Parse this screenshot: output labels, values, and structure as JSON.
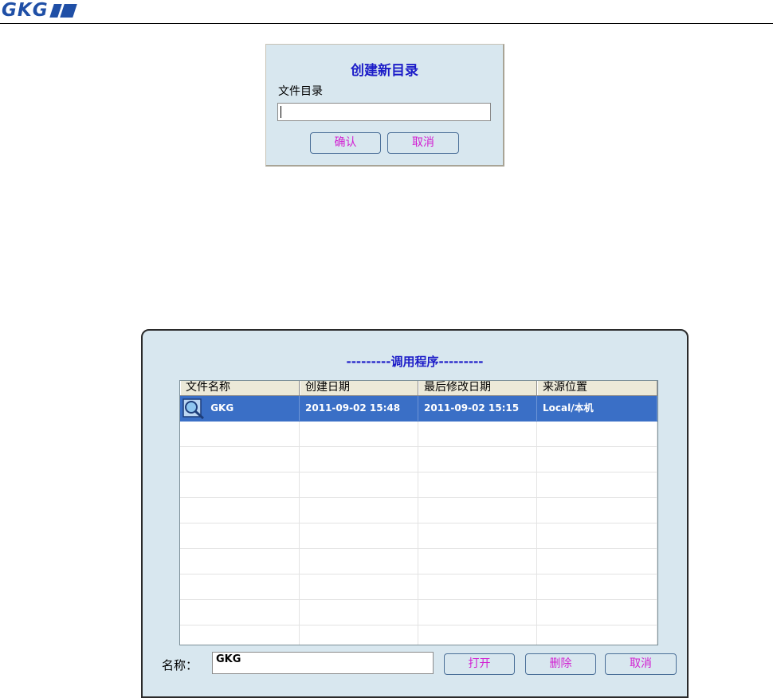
{
  "header": {
    "logo_text": "GKG"
  },
  "create_dir_dialog": {
    "title": "创建新目录",
    "label": "文件目录",
    "input_value": "",
    "confirm_label": "确认",
    "cancel_label": "取消"
  },
  "load_program_dialog": {
    "title": "---------调用程序---------",
    "columns": [
      "文件名称",
      "创建日期",
      "最后修改日期",
      "来源位置"
    ],
    "rows": [
      {
        "name": "GKG",
        "created": "2011-09-02 15:48",
        "modified": "2011-09-02 15:15",
        "source": "Local/本机",
        "selected": true,
        "icon": "magnifier-file-icon"
      }
    ],
    "name_label": "名称：",
    "name_value": "GKG",
    "open_label": "打开",
    "delete_label": "删除",
    "cancel_label": "取消"
  },
  "colors": {
    "brand": "#1f4fa6",
    "dialog_bg": "#d8e7ef",
    "title": "#1c1cc8",
    "button_text": "#d21fd2",
    "selection": "#3a6fc6"
  }
}
